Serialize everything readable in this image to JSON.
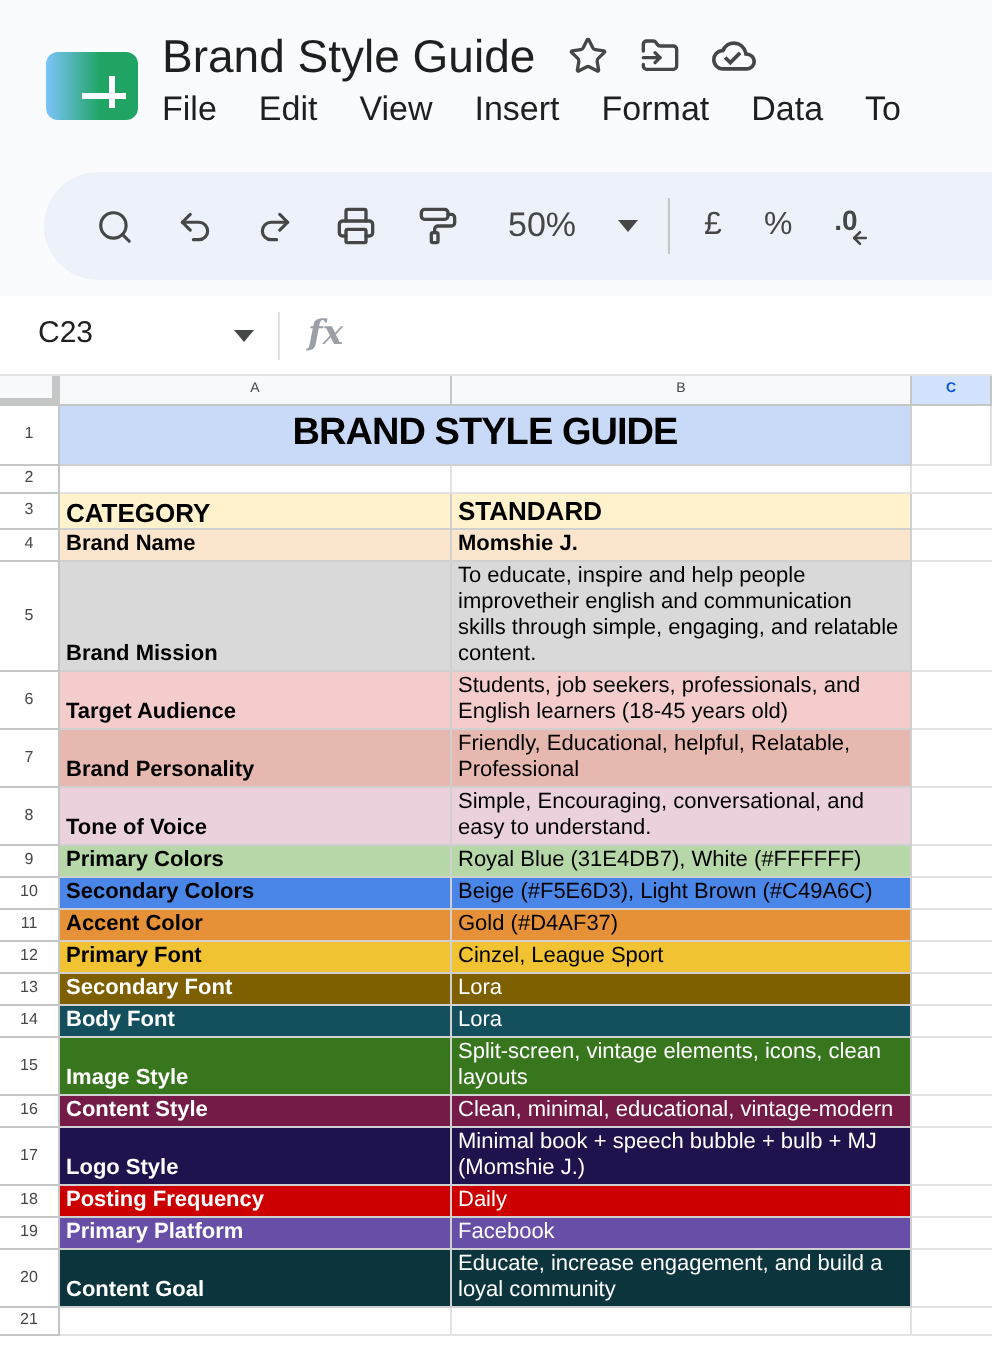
{
  "document": {
    "title": "Brand Style Guide"
  },
  "menu": [
    "File",
    "Edit",
    "View",
    "Insert",
    "Format",
    "Data",
    "To"
  ],
  "toolbar": {
    "zoom": "50%",
    "currency": "£",
    "percent": "%",
    "decimals": ".0"
  },
  "formula_bar": {
    "cell_ref": "C23",
    "fx": "fx"
  },
  "sheet": {
    "columns": [
      {
        "label": "A",
        "selected": false
      },
      {
        "label": "B",
        "selected": false
      },
      {
        "label": "C",
        "selected": true
      }
    ],
    "rows": [
      {
        "number": "1",
        "kind": "title",
        "text": "BRAND STYLE GUIDE",
        "color": "#c9daf8"
      },
      {
        "number": "2",
        "kind": "blank"
      },
      {
        "number": "3",
        "kind": "heading",
        "category": "CATEGORY",
        "standard": "STANDARD",
        "color": "#fff2cc"
      },
      {
        "number": "4",
        "kind": "highlight",
        "category": "Brand Name",
        "standard": "Momshie J.",
        "color": "#fce5cd"
      },
      {
        "number": "5",
        "kind": "entry",
        "category": "Brand Mission",
        "standard": "To educate, inspire and help people improvetheir english and communication skills through simple, engaging, and relatable content.",
        "color": "#d9d9d9"
      },
      {
        "number": "6",
        "kind": "entry",
        "category": "Target Audience",
        "standard": "Students, job seekers, professionals, and English learners (18-45 years old)",
        "color": "#f4cccc"
      },
      {
        "number": "7",
        "kind": "entry",
        "category": "Brand Personality",
        "standard": "Friendly, Educational, helpful, Relatable, Professional",
        "color": "#e6b8af"
      },
      {
        "number": "8",
        "kind": "entry",
        "category": "Tone of Voice",
        "standard": "Simple, Encouraging, conversational, and easy to understand.",
        "color": "#ead1dc"
      },
      {
        "number": "9",
        "kind": "entry",
        "category": "Primary Colors",
        "standard": "Royal Blue (31E4DB7), White (#FFFFFF)",
        "color": "#b6d7a8"
      },
      {
        "number": "10",
        "kind": "entry",
        "category": "Secondary Colors",
        "standard": "Beige (#F5E6D3), Light Brown (#C49A6C)",
        "color": "#4a86e8"
      },
      {
        "number": "11",
        "kind": "entry",
        "category": "Accent Color",
        "standard": "Gold (#D4AF37)",
        "color": "#e69138"
      },
      {
        "number": "12",
        "kind": "entry",
        "category": "Primary Font",
        "standard": "Cinzel, League Sport",
        "color": "#f1c232"
      },
      {
        "number": "13",
        "kind": "entry",
        "category": "Secondary Font",
        "standard": "Lora",
        "color": "#7f6000"
      },
      {
        "number": "14",
        "kind": "entry",
        "category": "Body Font",
        "standard": "Lora",
        "color": "#134f5c"
      },
      {
        "number": "15",
        "kind": "entry",
        "category": "Image Style",
        "standard": "Split-screen, vintage elements, icons, clean layouts",
        "color": "#38761d"
      },
      {
        "number": "16",
        "kind": "entry",
        "category": "Content Style",
        "standard": "Clean, minimal, educational, vintage-modern",
        "color": "#741b47"
      },
      {
        "number": "17",
        "kind": "entry",
        "category": "Logo Style",
        "standard": "Minimal book + speech bubble + bulb + MJ (Momshie J.)",
        "color": "#20124d"
      },
      {
        "number": "18",
        "kind": "entry",
        "category": "Posting Frequency",
        "standard": "Daily",
        "color": "#cc0000"
      },
      {
        "number": "19",
        "kind": "entry",
        "category": "Primary Platform",
        "standard": "Facebook",
        "color": "#674ea7"
      },
      {
        "number": "20",
        "kind": "entry",
        "category": "Content Goal",
        "standard": "Educate, increase engagement, and build a loyal community",
        "color": "#0c343d"
      },
      {
        "number": "21",
        "kind": "blank"
      }
    ]
  }
}
